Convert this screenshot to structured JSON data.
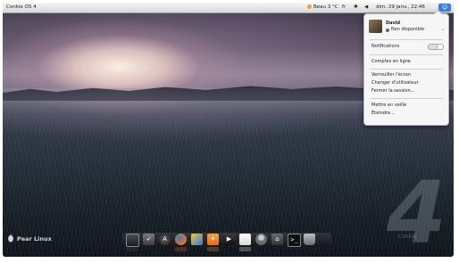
{
  "top_panel": {
    "app_title": "Conkie OS 4",
    "weather": "Beau 3 °C",
    "keyboard_layout": "fr",
    "datetime": "dim. 29 janv., 22:46",
    "bluetooth_icon": "bluetooth-icon",
    "volume_icon": "volume-icon",
    "user_icon": "user-icon"
  },
  "user_menu": {
    "name": "David",
    "status": "Non disponible",
    "items": [
      "Notifications",
      "Comptes en ligne",
      "Verrouiller l'écran",
      "Changer d'utilisateur",
      "Fermer la session...",
      "Mettre en veille",
      "Éteindre..."
    ]
  },
  "desktop": {
    "brand": "Pear Linux",
    "version_number": "4",
    "caption": "Conkie"
  },
  "dock": {
    "icons": [
      "monitor-icon",
      "rocket-icon",
      "app-store-icon",
      "firefox-icon",
      "photos-icon",
      "mail-icon",
      "video-icon",
      "text-editor-icon",
      "user-icon",
      "software-center-icon",
      "terminal-icon",
      "trash-icon"
    ]
  },
  "colors": {
    "panel_bg": "#e6e6e6",
    "menu_bg": "#f6f6f6",
    "accent": "#3c7fd1"
  }
}
